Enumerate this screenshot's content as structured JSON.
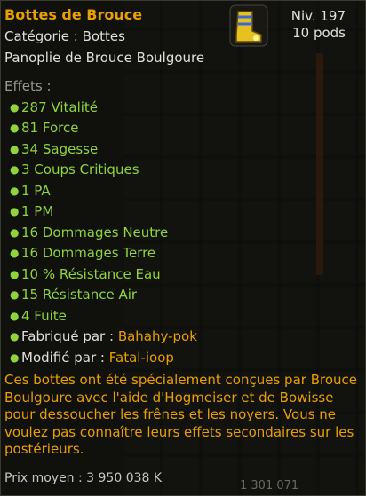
{
  "item": {
    "name": "Bottes de Brouce",
    "category": "Catégorie : Bottes",
    "panoply": "Panoplie de Brouce Boulgoure",
    "level": "Niv. 197",
    "weight": "10 pods",
    "icon": "boots-icon"
  },
  "effects_label": "Effets :",
  "effects": [
    "287 Vitalité",
    "81 Force",
    "34 Sagesse",
    "3 Coups Critiques",
    "1 PA",
    "1 PM",
    "16 Dommages Neutre",
    "16 Dommages Terre",
    "10 % Résistance Eau",
    "15 Résistance Air",
    "4 Fuite"
  ],
  "crafted_by": {
    "label": "Fabriqué par :",
    "name": "Bahahy-pok"
  },
  "modified_by": {
    "label": "Modifié par :",
    "name": "Fatal-ioop"
  },
  "description": "Ces bottes ont été spécialement conçues par Brouce Boulgoure avec l'aide d'Hogmeiser et de Bowisse pour dessoucher les frênes et les noyers. Vous ne voulez pas connaître leurs effets secondaires sur les postérieurs.",
  "price": "Prix moyen : 3 950 038 K",
  "background_number": "1 301 071",
  "colors": {
    "title": "#e8a000",
    "effect": "#8fd43a",
    "text": "#e0e0d8",
    "label": "#9a9a90"
  }
}
